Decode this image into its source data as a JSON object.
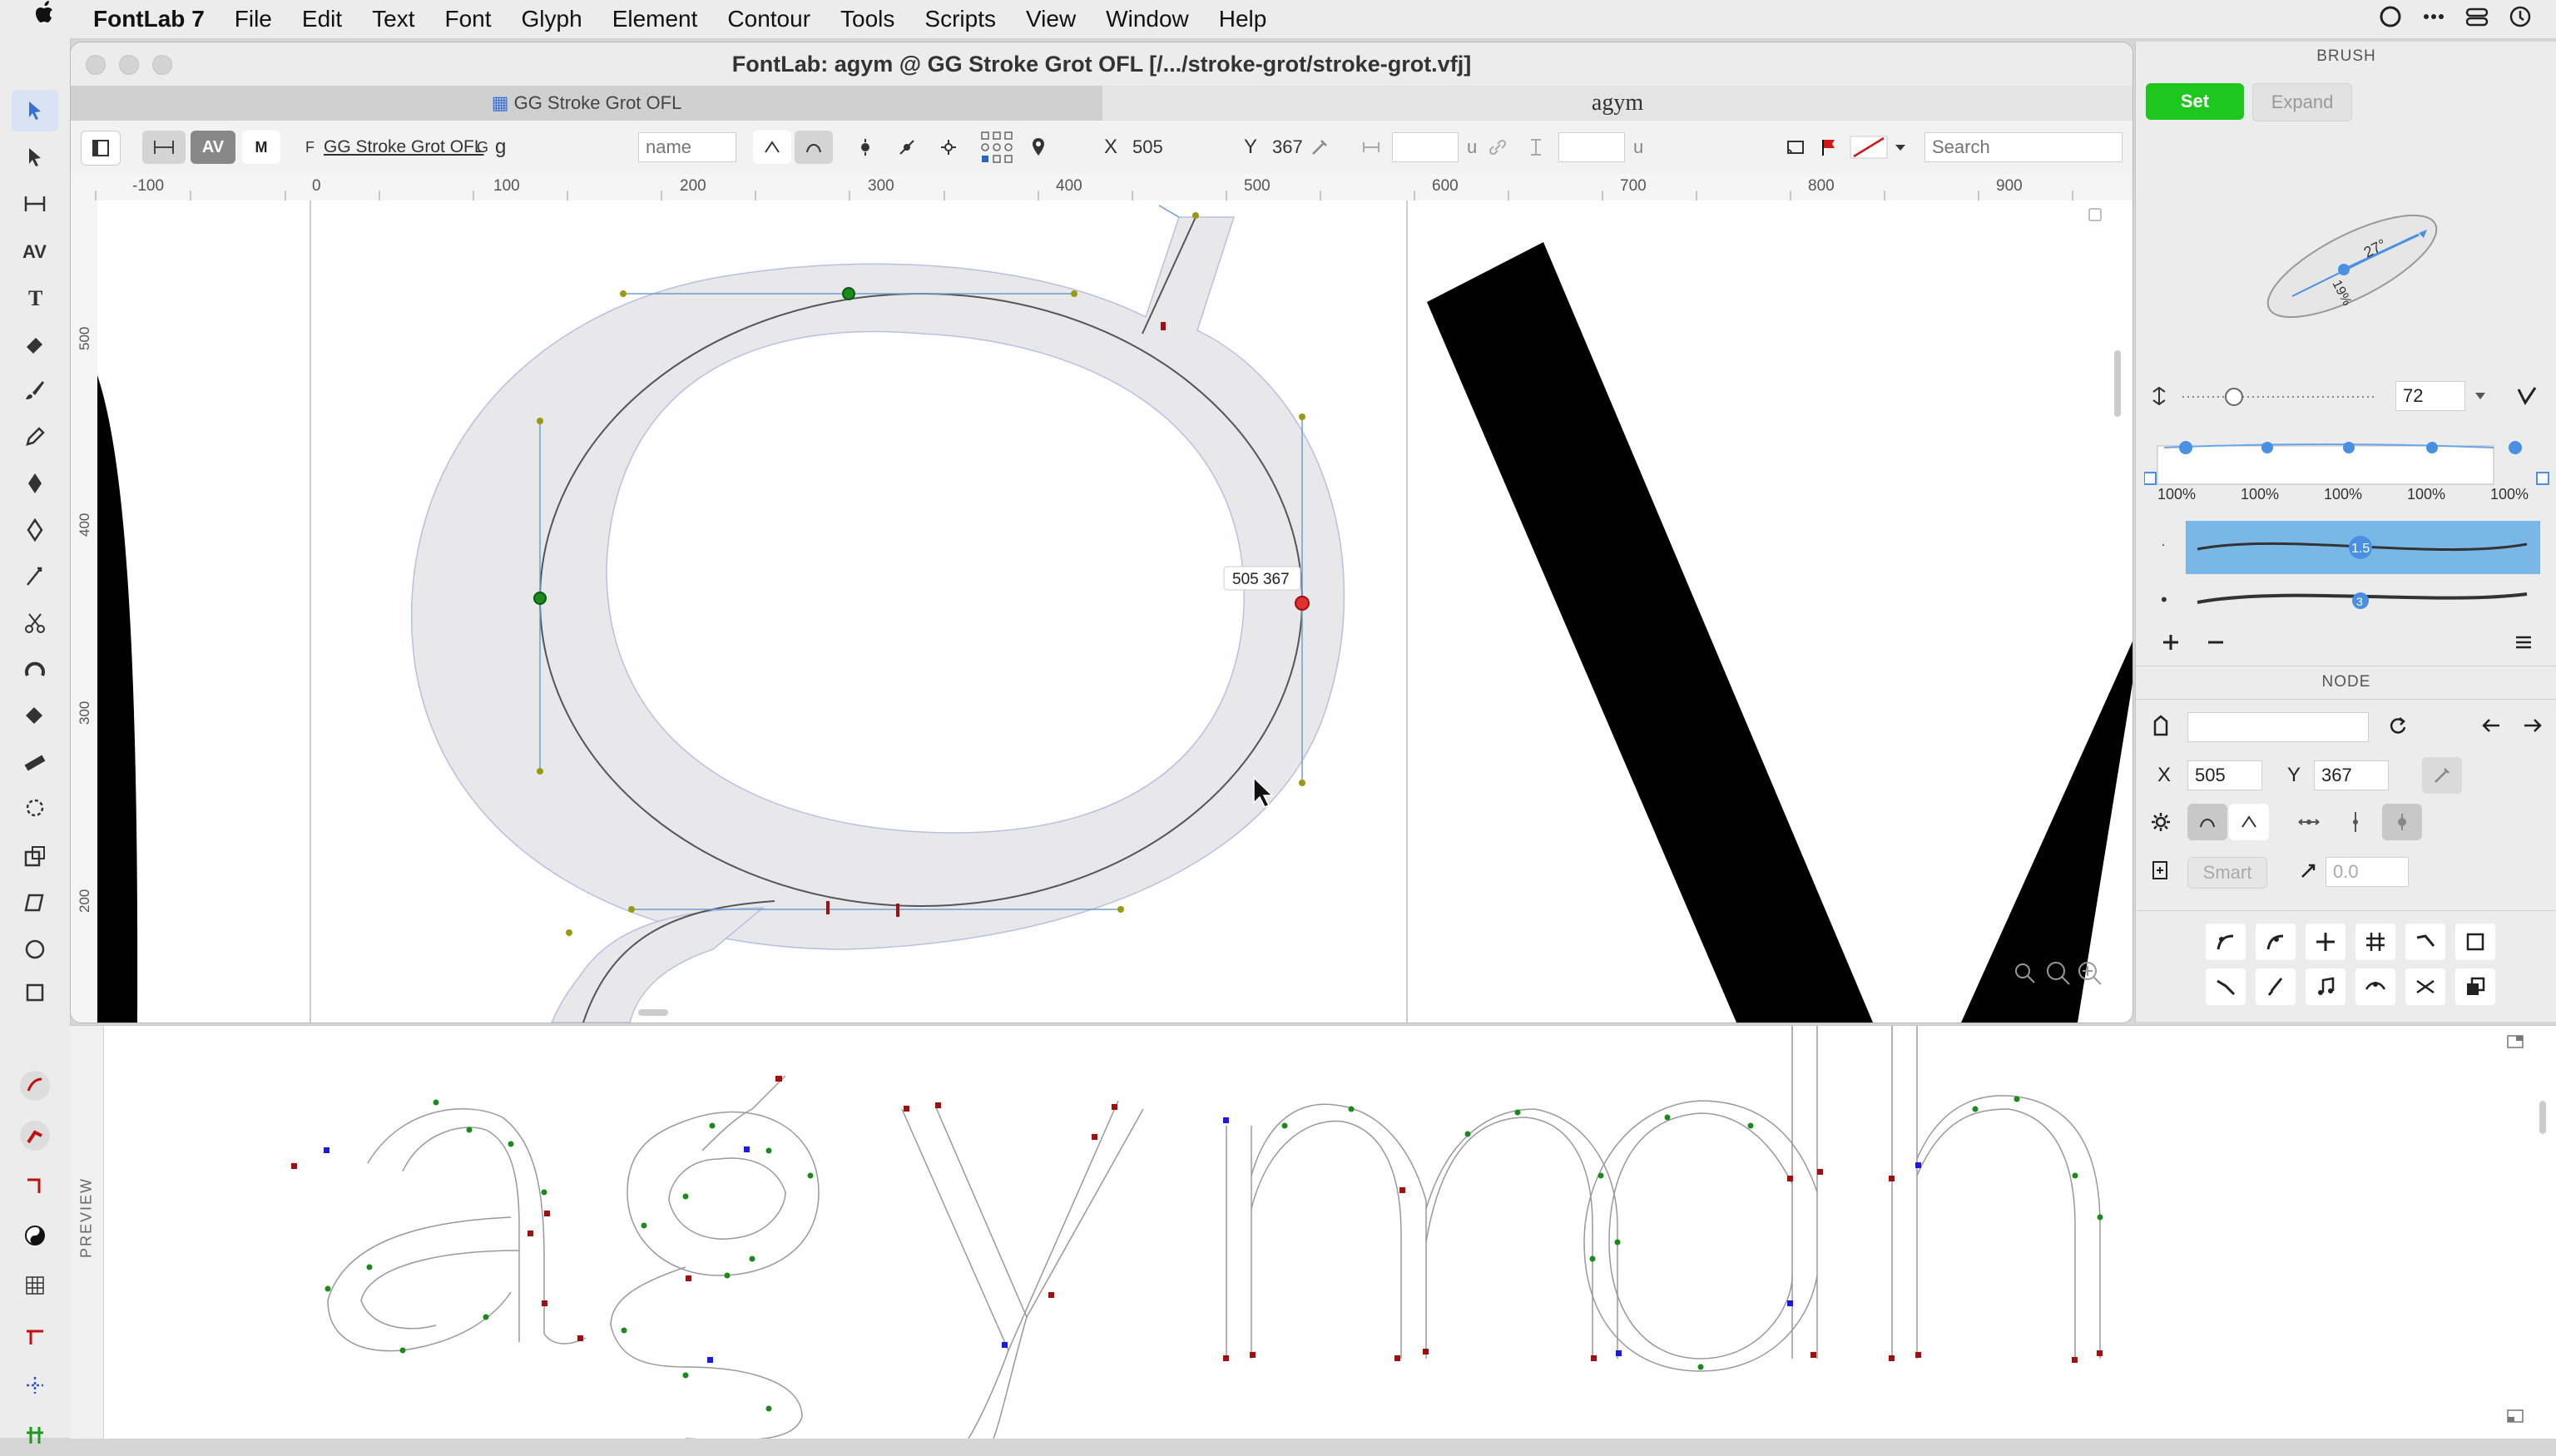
{
  "menubar": {
    "app_name": "FontLab 7",
    "items": [
      "File",
      "Edit",
      "Text",
      "Font",
      "Glyph",
      "Element",
      "Contour",
      "Tools",
      "Scripts",
      "View",
      "Window",
      "Help"
    ]
  },
  "window": {
    "title": "FontLab: agym @ GG Stroke Grot OFL [/.../stroke-grot/stroke-grot.vfj]",
    "tab_font": "GG Stroke Grot OFL",
    "tab_text": "agym"
  },
  "toolbar": {
    "font_prefix": "F",
    "font_name": "GG Stroke Grot OFL",
    "glyph_prefix": "G",
    "glyph_name": "g",
    "name_placeholder": "name",
    "x_label": "X",
    "x_value": "505",
    "y_label": "Y",
    "y_value": "367",
    "unit1": "u",
    "unit2": "u",
    "search_placeholder": "Search"
  },
  "ruler": {
    "h_ticks": [
      "-100",
      "0",
      "100",
      "200",
      "300",
      "400",
      "500",
      "600",
      "700",
      "800",
      "900"
    ],
    "v_ticks": [
      "500",
      "400",
      "300",
      "200"
    ]
  },
  "canvas": {
    "node_tooltip": "505  367"
  },
  "preview": {
    "label": "PREVIEW",
    "text": "agymdh"
  },
  "brush_panel": {
    "title": "BRUSH",
    "set_label": "Set",
    "expand_label": "Expand",
    "angle_label": "27°",
    "ratio_label": "19%",
    "size_value": "72",
    "percentages": [
      "100%",
      "100%",
      "100%",
      "100%",
      "100%"
    ],
    "profile1_value": "1.5",
    "profile2_value": "3"
  },
  "node_panel": {
    "title": "NODE",
    "x_label": "X",
    "x_value": "505",
    "y_label": "Y",
    "y_value": "367",
    "smart_label": "Smart",
    "tension_value": "0.0"
  },
  "colors": {
    "set_button": "#1ec71e",
    "selection_blue": "#79b8e6",
    "node_green": "#1a8a1a",
    "node_red": "#a01010",
    "node_blue": "#1a1ae0"
  }
}
